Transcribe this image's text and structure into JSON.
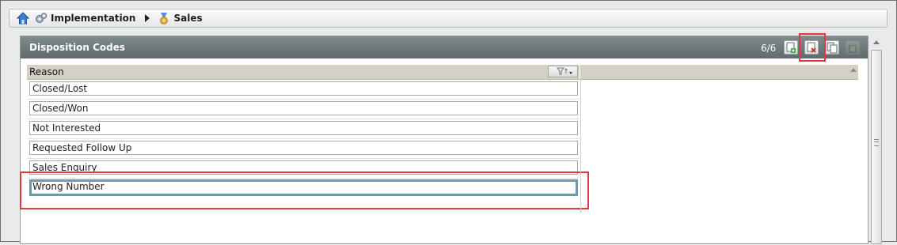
{
  "breadcrumb": {
    "items": [
      {
        "label": "",
        "icon": "home-icon"
      },
      {
        "label": "Implementation",
        "icon": "gears-icon"
      },
      {
        "label": "Sales",
        "icon": "medal-icon"
      }
    ]
  },
  "panel": {
    "title": "Disposition Codes",
    "count": "6/6",
    "toolbar": [
      {
        "icon": "add-record-icon",
        "enabled": true
      },
      {
        "icon": "delete-record-icon",
        "enabled": true,
        "highlighted": true
      },
      {
        "icon": "copy-record-icon",
        "enabled": true
      },
      {
        "icon": "trash-icon",
        "enabled": false
      }
    ]
  },
  "grid": {
    "column": "Reason",
    "filter_icon": "filter-sort-icon",
    "rows": [
      {
        "value": "Closed/Lost"
      },
      {
        "value": "Closed/Won"
      },
      {
        "value": "Not Interested"
      },
      {
        "value": "Requested Follow Up"
      },
      {
        "value": "Sales Enquiry"
      },
      {
        "value": "Wrong Number",
        "active": true,
        "highlighted": true
      }
    ]
  },
  "colors": {
    "panel_header": "#6f7b7c",
    "highlight": "#e0393c",
    "active_border": "#6a9cb0",
    "grid_header": "#d4d0c4"
  }
}
